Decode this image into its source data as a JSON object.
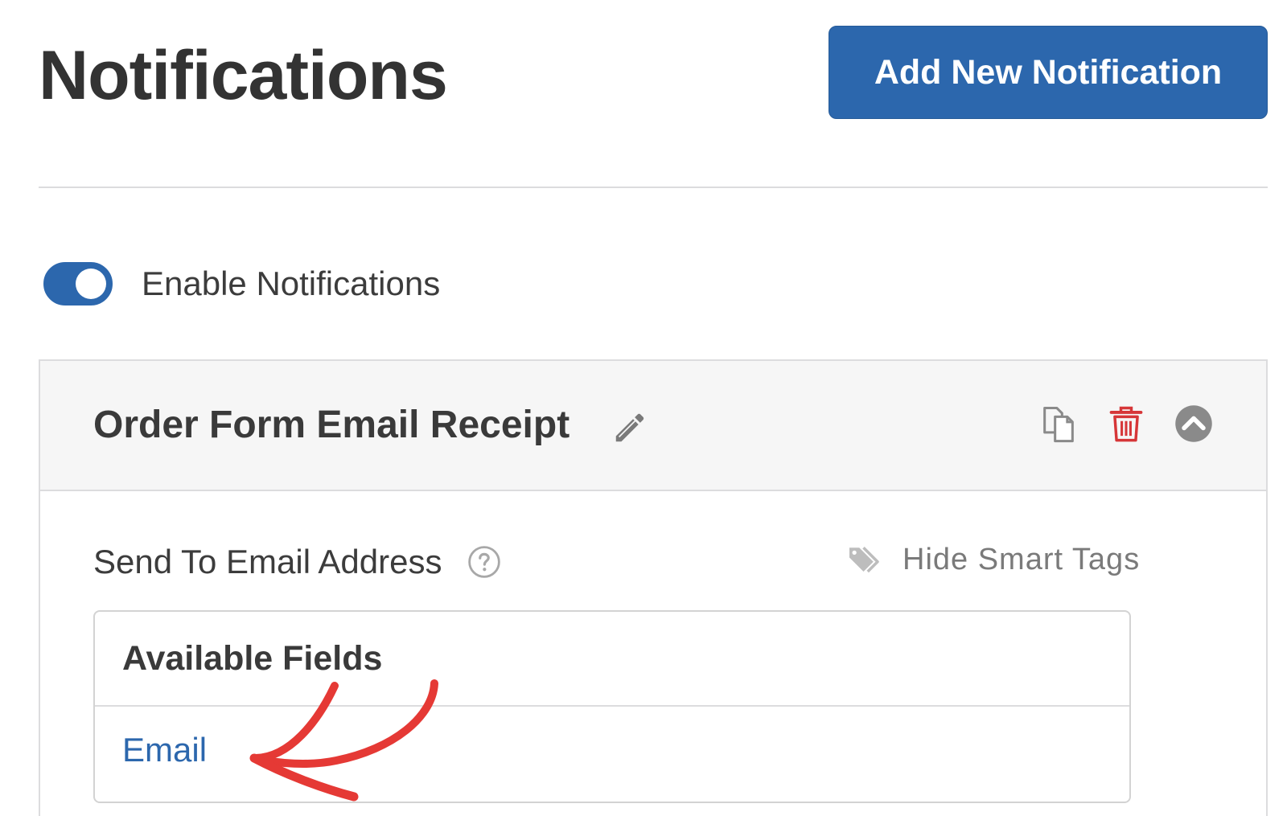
{
  "page": {
    "title": "Notifications",
    "add_button_label": "Add New Notification"
  },
  "settings": {
    "enable_label": "Enable Notifications",
    "enabled": true
  },
  "notification": {
    "name": "Order Form Email Receipt",
    "icons": {
      "edit": "pencil-icon",
      "duplicate": "copy-icon",
      "delete": "trash-icon",
      "collapse": "chevron-up-circle-icon"
    },
    "send_to": {
      "label": "Send To Email Address",
      "help_icon": "question-circle-icon",
      "smart_tags_label": "Hide Smart Tags",
      "smart_tags_icon": "tag-icon",
      "available_fields_title": "Available Fields",
      "fields": [
        "Email"
      ]
    }
  },
  "colors": {
    "primary": "#2c67ad",
    "text": "#333333",
    "delete": "#d63638",
    "annotation": "#e53935",
    "header_bg": "#f6f6f6",
    "border": "#dcdcde"
  }
}
